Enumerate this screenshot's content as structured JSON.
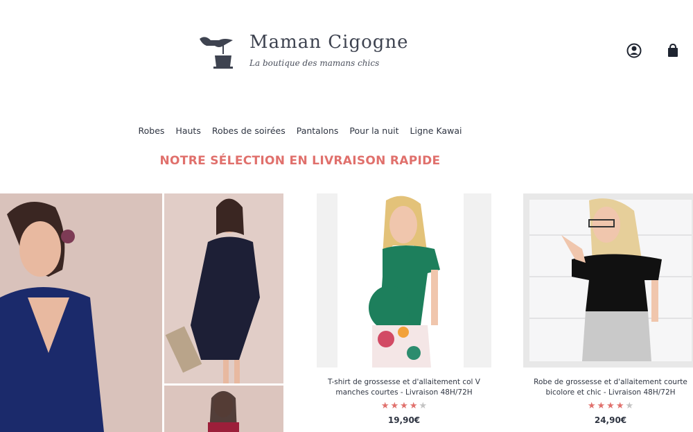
{
  "brand": {
    "title": "Maman Cigogne",
    "tagline": "La boutique des mamans chics"
  },
  "header": {
    "account_icon": "user-circle-icon",
    "cart_icon": "shopping-bag-icon"
  },
  "nav": {
    "items": [
      {
        "label": "Robes"
      },
      {
        "label": "Hauts"
      },
      {
        "label": "Robes de soirées"
      },
      {
        "label": "Pantalons"
      },
      {
        "label": "Pour la nuit"
      },
      {
        "label": "Ligne Kawai"
      }
    ]
  },
  "section": {
    "title": "NOTRE SÉLECTION EN LIVRAISON RAPIDE"
  },
  "products": [
    {
      "name": "T-shirt de grossesse et d'allaitement col V manches courtes - Livraison 48H/72H",
      "rating": 4,
      "rating_max": 5,
      "price": "19,90€"
    },
    {
      "name": "Robe de grossesse et d'allaitement courte bicolore et chic - Livraison 48H/72H",
      "rating": 4,
      "rating_max": 5,
      "price": "24,90€"
    }
  ],
  "colors": {
    "accent": "#e0706c",
    "text": "#2f3542",
    "star_empty": "#c3c3c3"
  }
}
